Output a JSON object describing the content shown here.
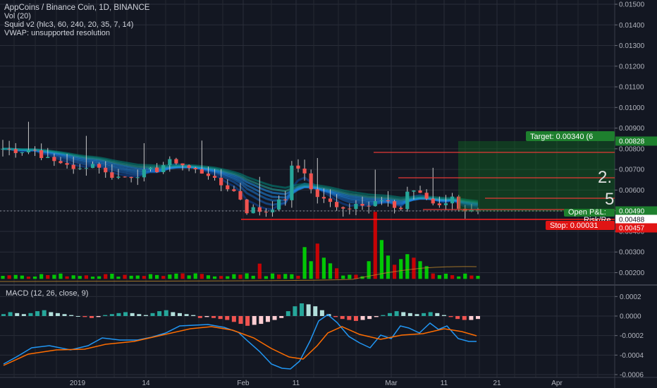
{
  "header": {
    "title": "AppCoins / Binance Coin, 1D, BINANCE",
    "indicators": [
      "Vol (20)",
      "Squid v2 (hlc3, 60, 240, 20, 35, 7, 14)",
      "VWAP: unsupported resolution"
    ]
  },
  "macd_label": "MACD (12, 26, close, 9)",
  "labels": {
    "target": "Target: 0.00340 (6",
    "open_pl": "Open P&L:",
    "risk": "Risk/Re",
    "stop": "Stop: 0.00031",
    "ratio_top": "2.",
    "ratio_bottom": "5"
  },
  "colors": {
    "background": "#131722",
    "up": "#26a69a",
    "down": "#ef5350",
    "vol_up": "#00e600",
    "vol_down": "#e60000",
    "macd": "#2196f3",
    "signal": "#ff6d00",
    "target_box": "#0e7a1f",
    "stop_line": "#ff1e1e"
  },
  "chart_data": [
    {
      "type": "candlestick",
      "title": "AppCoins / Binance Coin, 1D, BINANCE",
      "y_ticks": [
        "0.01500",
        "0.01400",
        "0.01300",
        "0.01200",
        "0.01100",
        "0.01000",
        "0.00900",
        "0.00800",
        "0.00700",
        "0.00600",
        "0.00500",
        "0.00400",
        "0.00300",
        "0.00200"
      ],
      "x_ticks": [
        "2019",
        "14",
        "Feb",
        "11",
        "Mar",
        "11",
        "21",
        "Apr"
      ],
      "ylim": [
        0.00175,
        0.0151
      ],
      "price_markers": [
        {
          "label": "0.00828",
          "value": 0.00828,
          "kind": "target"
        },
        {
          "label": "0.00490",
          "value": 0.0049,
          "kind": "last"
        },
        {
          "label": "0.00488",
          "value": 0.00488,
          "kind": "last"
        },
        {
          "label": "0.00457",
          "value": 0.00457,
          "kind": "stop"
        }
      ],
      "horizontal_levels": [
        0.0077,
        0.0065,
        0.0056,
        0.00465
      ],
      "series": [
        {
          "name": "Vol (20)",
          "values": []
        }
      ]
    },
    {
      "type": "line",
      "title": "MACD (12, 26, close, 9)",
      "y_ticks": [
        "0.0002",
        "0.0000",
        "-0.0002",
        "-0.0004",
        "-0.0006"
      ],
      "ylim": [
        -0.00063,
        0.00025
      ]
    }
  ]
}
